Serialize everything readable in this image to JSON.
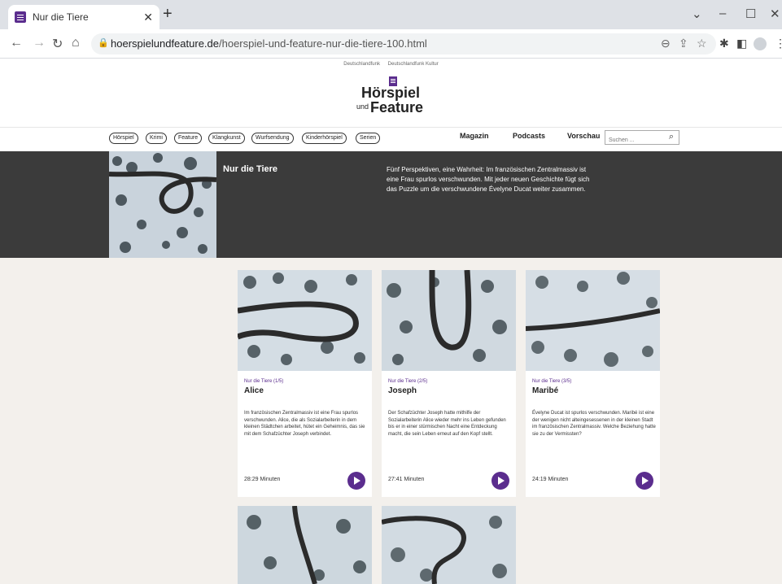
{
  "browser": {
    "tab_title": "Nur die Tiere",
    "tab_close": "✕",
    "new_tab": "+",
    "url_domain": "hoerspielundfeature.de",
    "url_path": "/hoerspiel-und-feature-nur-die-tiere-100.html",
    "icons": [
      "back-icon",
      "forward-icon",
      "reload-icon",
      "home-icon",
      "lock-icon",
      "zoom-icon",
      "share-icon",
      "star-icon",
      "extensions-icon",
      "sidepanel-icon",
      "profile-icon",
      "menu-icon"
    ]
  },
  "site": {
    "top_links": [
      "Deutschlandfunk",
      "Deutschlandfunk Kultur"
    ],
    "logo_line1": "Hörspiel",
    "logo_und": "und",
    "logo_line2": "Feature",
    "brand_color": "#5b2d8e",
    "nav_pills": [
      "Hörspiel",
      "Krimi",
      "Feature",
      "Klangkunst",
      "Wurfsendung",
      "Kinderhörspiel",
      "Serien"
    ],
    "nav_links": [
      "Magazin",
      "Podcasts",
      "Vorschau"
    ],
    "search_placeholder": "Suchen ..."
  },
  "hero": {
    "title": "Nur die Tiere",
    "description": "Fünf Perspektiven, eine Wahrheit: Im französischen Zentralmassiv ist eine Frau spurlos verschwunden. Mit jeder neuen Geschichte fügt sich das Puzzle um die verschwundene Évelyne Ducat weiter zusammen."
  },
  "episodes": [
    {
      "series": "Nur die Tiere (1/5)",
      "title": "Alice",
      "text": "Im französischen Zentralmassiv ist eine Frau spurlos verschwunden. Alice, die als Sozialarbeiterin in dem kleinen Städtchen arbeitet, hütet ein Geheimnis, das sie mit dem Schafzüchter Joseph verbindet.",
      "duration": "28:29 Minuten"
    },
    {
      "series": "Nur die Tiere (2/5)",
      "title": "Joseph",
      "text": "Der Schafzüchter Joseph hatte mithilfe der Sozialarbeiterin Alice wieder mehr ins Leben gefunden bis er in einer stürmischen Nacht eine Entdeckung macht, die sein Leben erneut auf den Kopf stellt.",
      "duration": "27:41 Minuten"
    },
    {
      "series": "Nur die Tiere (3/5)",
      "title": "Maribé",
      "text": "Évelyne Ducat ist spurlos verschwunden. Maribé ist eine der wenigen nicht alteingesessenen in der kleinen Stadt im französischen Zentralmassiv. Welche Beziehung hatte sie zu der Vermissten?",
      "duration": "24:19 Minuten"
    }
  ]
}
